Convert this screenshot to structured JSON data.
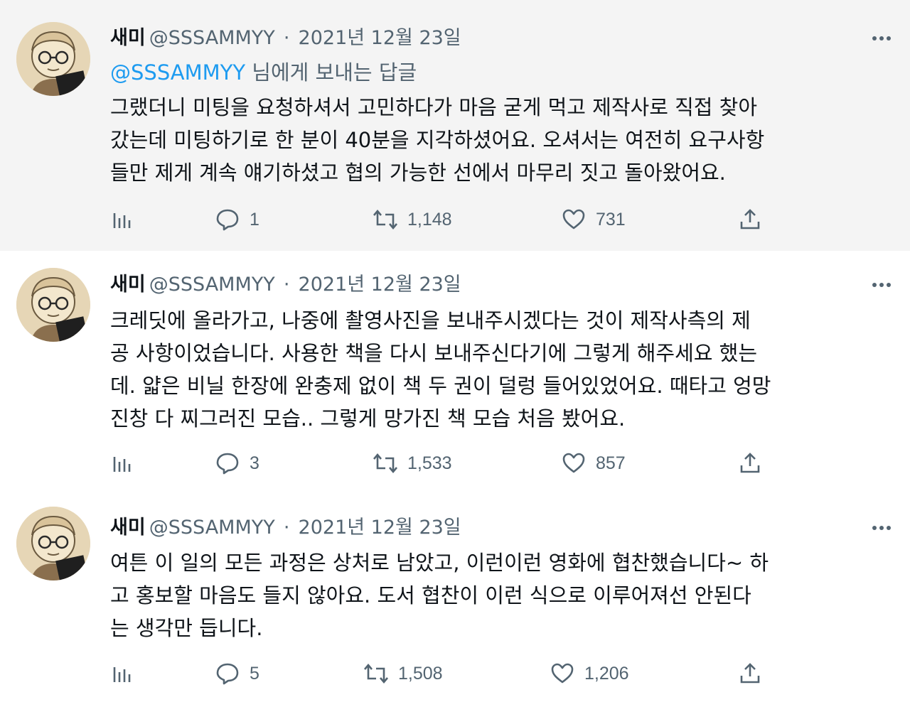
{
  "tweets": [
    {
      "author_name": "새미",
      "author_handle": "@SSSAMMYY",
      "separator": "·",
      "date": "2021년 12월 23일",
      "replying_to_handle": "@SSSAMMYY",
      "replying_to_suffix": " 님에게 보내는 답글",
      "lines": [
        "그랬더니 미팅을 요청하셔서 고민하다가 마음 굳게 먹고 제작사로 직접 찾아",
        "갔는데 미팅하기로 한 분이 40분을 지각하셨어요. 오셔서는 여전히 요구사항",
        "들만 제게 계속 얘기하셨고 협의 가능한 선에서 마무리 짓고 돌아왔어요."
      ],
      "stats": {
        "replies": "1",
        "retweets": "1,148",
        "likes": "731"
      }
    },
    {
      "author_name": "새미",
      "author_handle": "@SSSAMMYY",
      "separator": "·",
      "date": "2021년 12월 23일",
      "lines": [
        "크레딧에 올라가고, 나중에 촬영사진을 보내주시겠다는 것이 제작사측의 제",
        "공 사항이었습니다. 사용한 책을 다시 보내주신다기에 그렇게 해주세요 했는",
        "데. 얇은 비닐 한장에 완충제 없이 책 두 권이 덜렁 들어있었어요. 때타고 엉망",
        "진창 다 찌그러진 모습.. 그렇게 망가진 책 모습 처음 봤어요."
      ],
      "stats": {
        "replies": "3",
        "retweets": "1,533",
        "likes": "857"
      }
    },
    {
      "author_name": "새미",
      "author_handle": "@SSSAMMYY",
      "separator": "·",
      "date": "2021년 12월 23일",
      "lines": [
        "여튼 이 일의 모든 과정은 상처로 남았고, 이런이런 영화에 협찬했습니다~ 하",
        "고 홍보할 마음도 들지 않아요. 도서 협찬이 이런 식으로 이루어져선 안된다",
        "는 생각만 듭니다."
      ],
      "stats": {
        "replies": "5",
        "retweets": "1,508",
        "likes": "1,206"
      }
    }
  ],
  "icons": {
    "analytics": "bar-chart-icon",
    "reply": "speech-bubble-icon",
    "retweet": "retweet-arrows-icon",
    "like": "heart-icon",
    "share": "share-upload-icon",
    "more": "ellipsis-icon"
  },
  "colors": {
    "text_primary": "#0f1419",
    "text_secondary": "#536471",
    "link": "#1d9bf0",
    "highlight_background": "#f4f4f4",
    "thread_line": "#cfd9de"
  }
}
